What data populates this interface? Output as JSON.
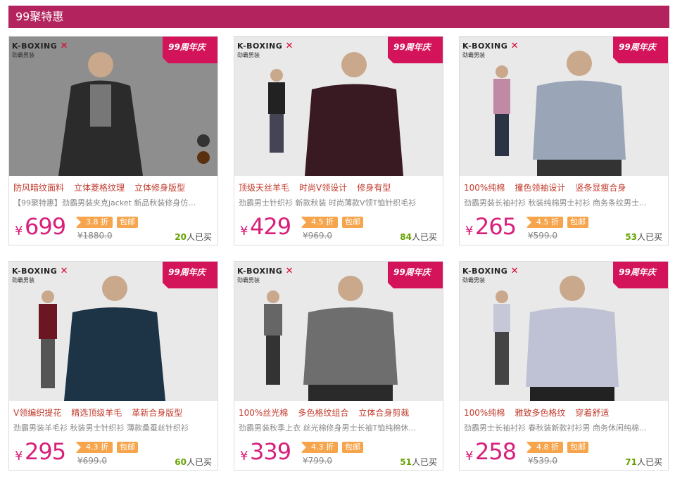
{
  "header": {
    "title": "99聚特惠"
  },
  "brand": {
    "name": "K-BOXING",
    "sub": "劲霸男装",
    "badge": "99周年庆"
  },
  "labels": {
    "discount_suffix": "折",
    "free_shipping": "包邮",
    "bought_suffix": "人已买",
    "currency": "¥"
  },
  "products": [
    {
      "features": [
        "防风暗纹面料",
        "立体菱格纹理",
        "立体修身版型"
      ],
      "desc": "【99聚特惠】劲霸男装夹克jacket 新品秋装修身仿…",
      "price": "699",
      "discount": "3.8 折",
      "original": "¥1880.0",
      "sold": "20",
      "colors": {
        "bg": "#8e8e8e",
        "garment": "#2b2b2b"
      }
    },
    {
      "features": [
        "顶级天丝羊毛",
        "时尚V领设计",
        "修身有型"
      ],
      "desc": "劲霸男士针织衫 新款秋装 时尚薄款V领T恤针织毛衫",
      "price": "429",
      "discount": "4.5 折",
      "original": "¥969.0",
      "sold": "84",
      "colors": {
        "bg": "#e9e9e9",
        "garment": "#3a1a22"
      }
    },
    {
      "features": [
        "100%纯棉",
        "撞色领袖设计",
        "竖条显瘦合身"
      ],
      "desc": "劲霸男装长袖衬衫 秋装纯棉男士衬衫 商务条纹男士…",
      "price": "265",
      "discount": "4.5 折",
      "original": "¥599.0",
      "sold": "53",
      "colors": {
        "bg": "#e9e9e9",
        "garment": "#9aa6b8"
      }
    },
    {
      "features": [
        "V领编织提花",
        "精选顶级羊毛",
        "革新合身版型"
      ],
      "desc": "劲霸男装羊毛衫 秋装男士针织衫 薄款桑蚕丝针织衫",
      "price": "295",
      "discount": "4.3 折",
      "original": "¥699.0",
      "sold": "60",
      "colors": {
        "bg": "#e9e9e9",
        "garment": "#1d3346"
      }
    },
    {
      "features": [
        "100%丝光棉",
        "多色格纹组合",
        "立体合身剪裁"
      ],
      "desc": "劲霸男装秋季上衣 丝光棉修身男士长袖T恤纯棉休…",
      "price": "339",
      "discount": "4.3 折",
      "original": "¥799.0",
      "sold": "51",
      "colors": {
        "bg": "#e9e9e9",
        "garment": "#6e6e6e"
      }
    },
    {
      "features": [
        "100%纯棉",
        "雅致多色格纹",
        "穿着舒适"
      ],
      "desc": "劲霸男士长袖衬衫 春秋装新款衬衫男 商务休闲纯棉…",
      "price": "258",
      "discount": "4.8 折",
      "original": "¥539.0",
      "sold": "71",
      "colors": {
        "bg": "#e9e9e9",
        "garment": "#bfc2d4"
      }
    }
  ]
}
